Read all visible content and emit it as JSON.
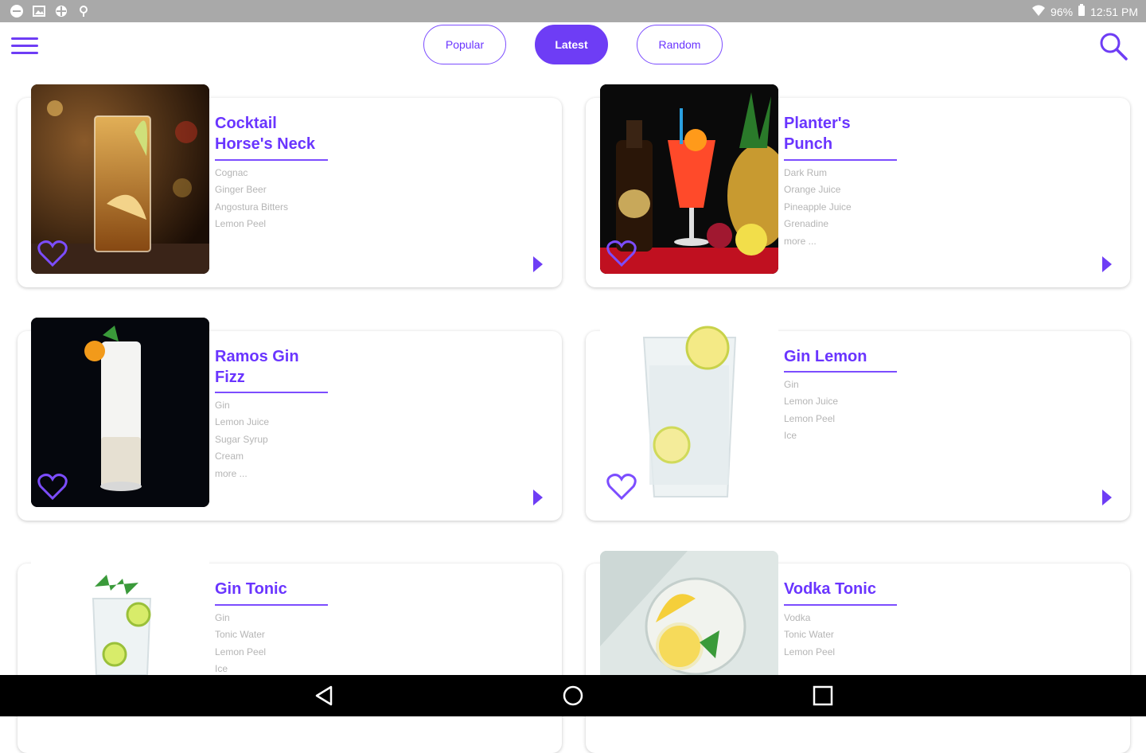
{
  "status_bar": {
    "battery": "96%",
    "time": "12:51 PM",
    "icons": [
      "dnd-icon",
      "image-icon",
      "android-icon",
      "location-icon",
      "wifi-icon",
      "battery-icon"
    ]
  },
  "header": {
    "tabs": [
      {
        "label": "Popular",
        "active": false
      },
      {
        "label": "Latest",
        "active": true
      },
      {
        "label": "Random",
        "active": false
      }
    ],
    "icons": [
      "hamburger-menu-icon",
      "search-icon"
    ]
  },
  "cocktails": [
    {
      "title_1": "Cocktail",
      "title_2": "Horse's Neck",
      "ingredients": [
        "Cognac",
        "Ginger Beer",
        "Angostura Bitters",
        "Lemon Peel"
      ]
    },
    {
      "title_1": "Planter's",
      "title_2": "Punch",
      "ingredients": [
        "Dark Rum",
        "Orange Juice",
        "Pineapple Juice",
        "Grenadine",
        "more ..."
      ]
    },
    {
      "title_1": "Ramos Gin",
      "title_2": "Fizz",
      "ingredients": [
        "Gin",
        "Lemon Juice",
        "Sugar Syrup",
        "Cream",
        "more ..."
      ]
    },
    {
      "title_1": "Gin Lemon",
      "title_2": "",
      "ingredients": [
        "Gin",
        "Lemon Juice",
        "Lemon Peel",
        "Ice"
      ]
    },
    {
      "title_1": "Gin Tonic",
      "title_2": "",
      "ingredients": [
        "Gin",
        "Tonic Water",
        "Lemon Peel",
        "Ice"
      ]
    },
    {
      "title_1": "Vodka Tonic",
      "title_2": "",
      "ingredients": [
        "Vodka",
        "Tonic Water",
        "Lemon Peel"
      ]
    }
  ],
  "colors": {
    "accent": "#6e3df5",
    "status_bar": "#a9a9a9",
    "ingredient_text": "#b5b5b5"
  },
  "nav_bar": {
    "icons": [
      "back-icon",
      "home-icon",
      "recents-icon"
    ]
  }
}
